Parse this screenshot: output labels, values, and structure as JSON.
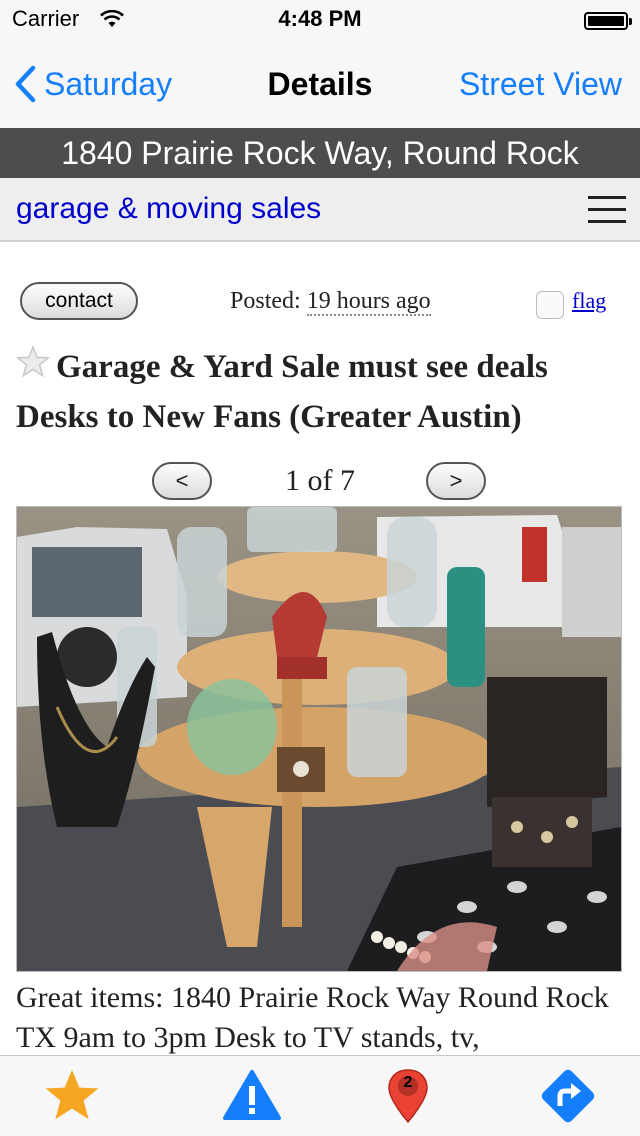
{
  "status_bar": {
    "carrier": "Carrier",
    "time": "4:48 PM"
  },
  "nav": {
    "back_label": "Saturday",
    "title": "Details",
    "right_label": "Street View"
  },
  "address": "1840 Prairie Rock Way, Round Rock",
  "category": {
    "label": "garage & moving sales"
  },
  "post": {
    "contact_label": "contact",
    "posted_prefix": "Posted:",
    "posted_time": "19 hours ago",
    "flag_label": "flag",
    "title": "Garage & Yard Sale must see deals Desks to New Fans (Greater Austin)"
  },
  "gallery": {
    "prev": "<",
    "next": ">",
    "counter": "1 of 7"
  },
  "description": "Great items: 1840 Prairie Rock Way Round Rock TX 9am to 3pm Desk to TV stands, tv,",
  "tab_bar": {
    "items": [
      {
        "icon": "star-icon"
      },
      {
        "icon": "warning-icon"
      },
      {
        "icon": "map-pin-icon",
        "badge": "2"
      },
      {
        "icon": "directions-icon"
      }
    ]
  },
  "colors": {
    "ios_blue": "#157efb",
    "link_blue": "#0000cc",
    "address_bar": "#4d4d4d",
    "star": "#f5a623"
  }
}
